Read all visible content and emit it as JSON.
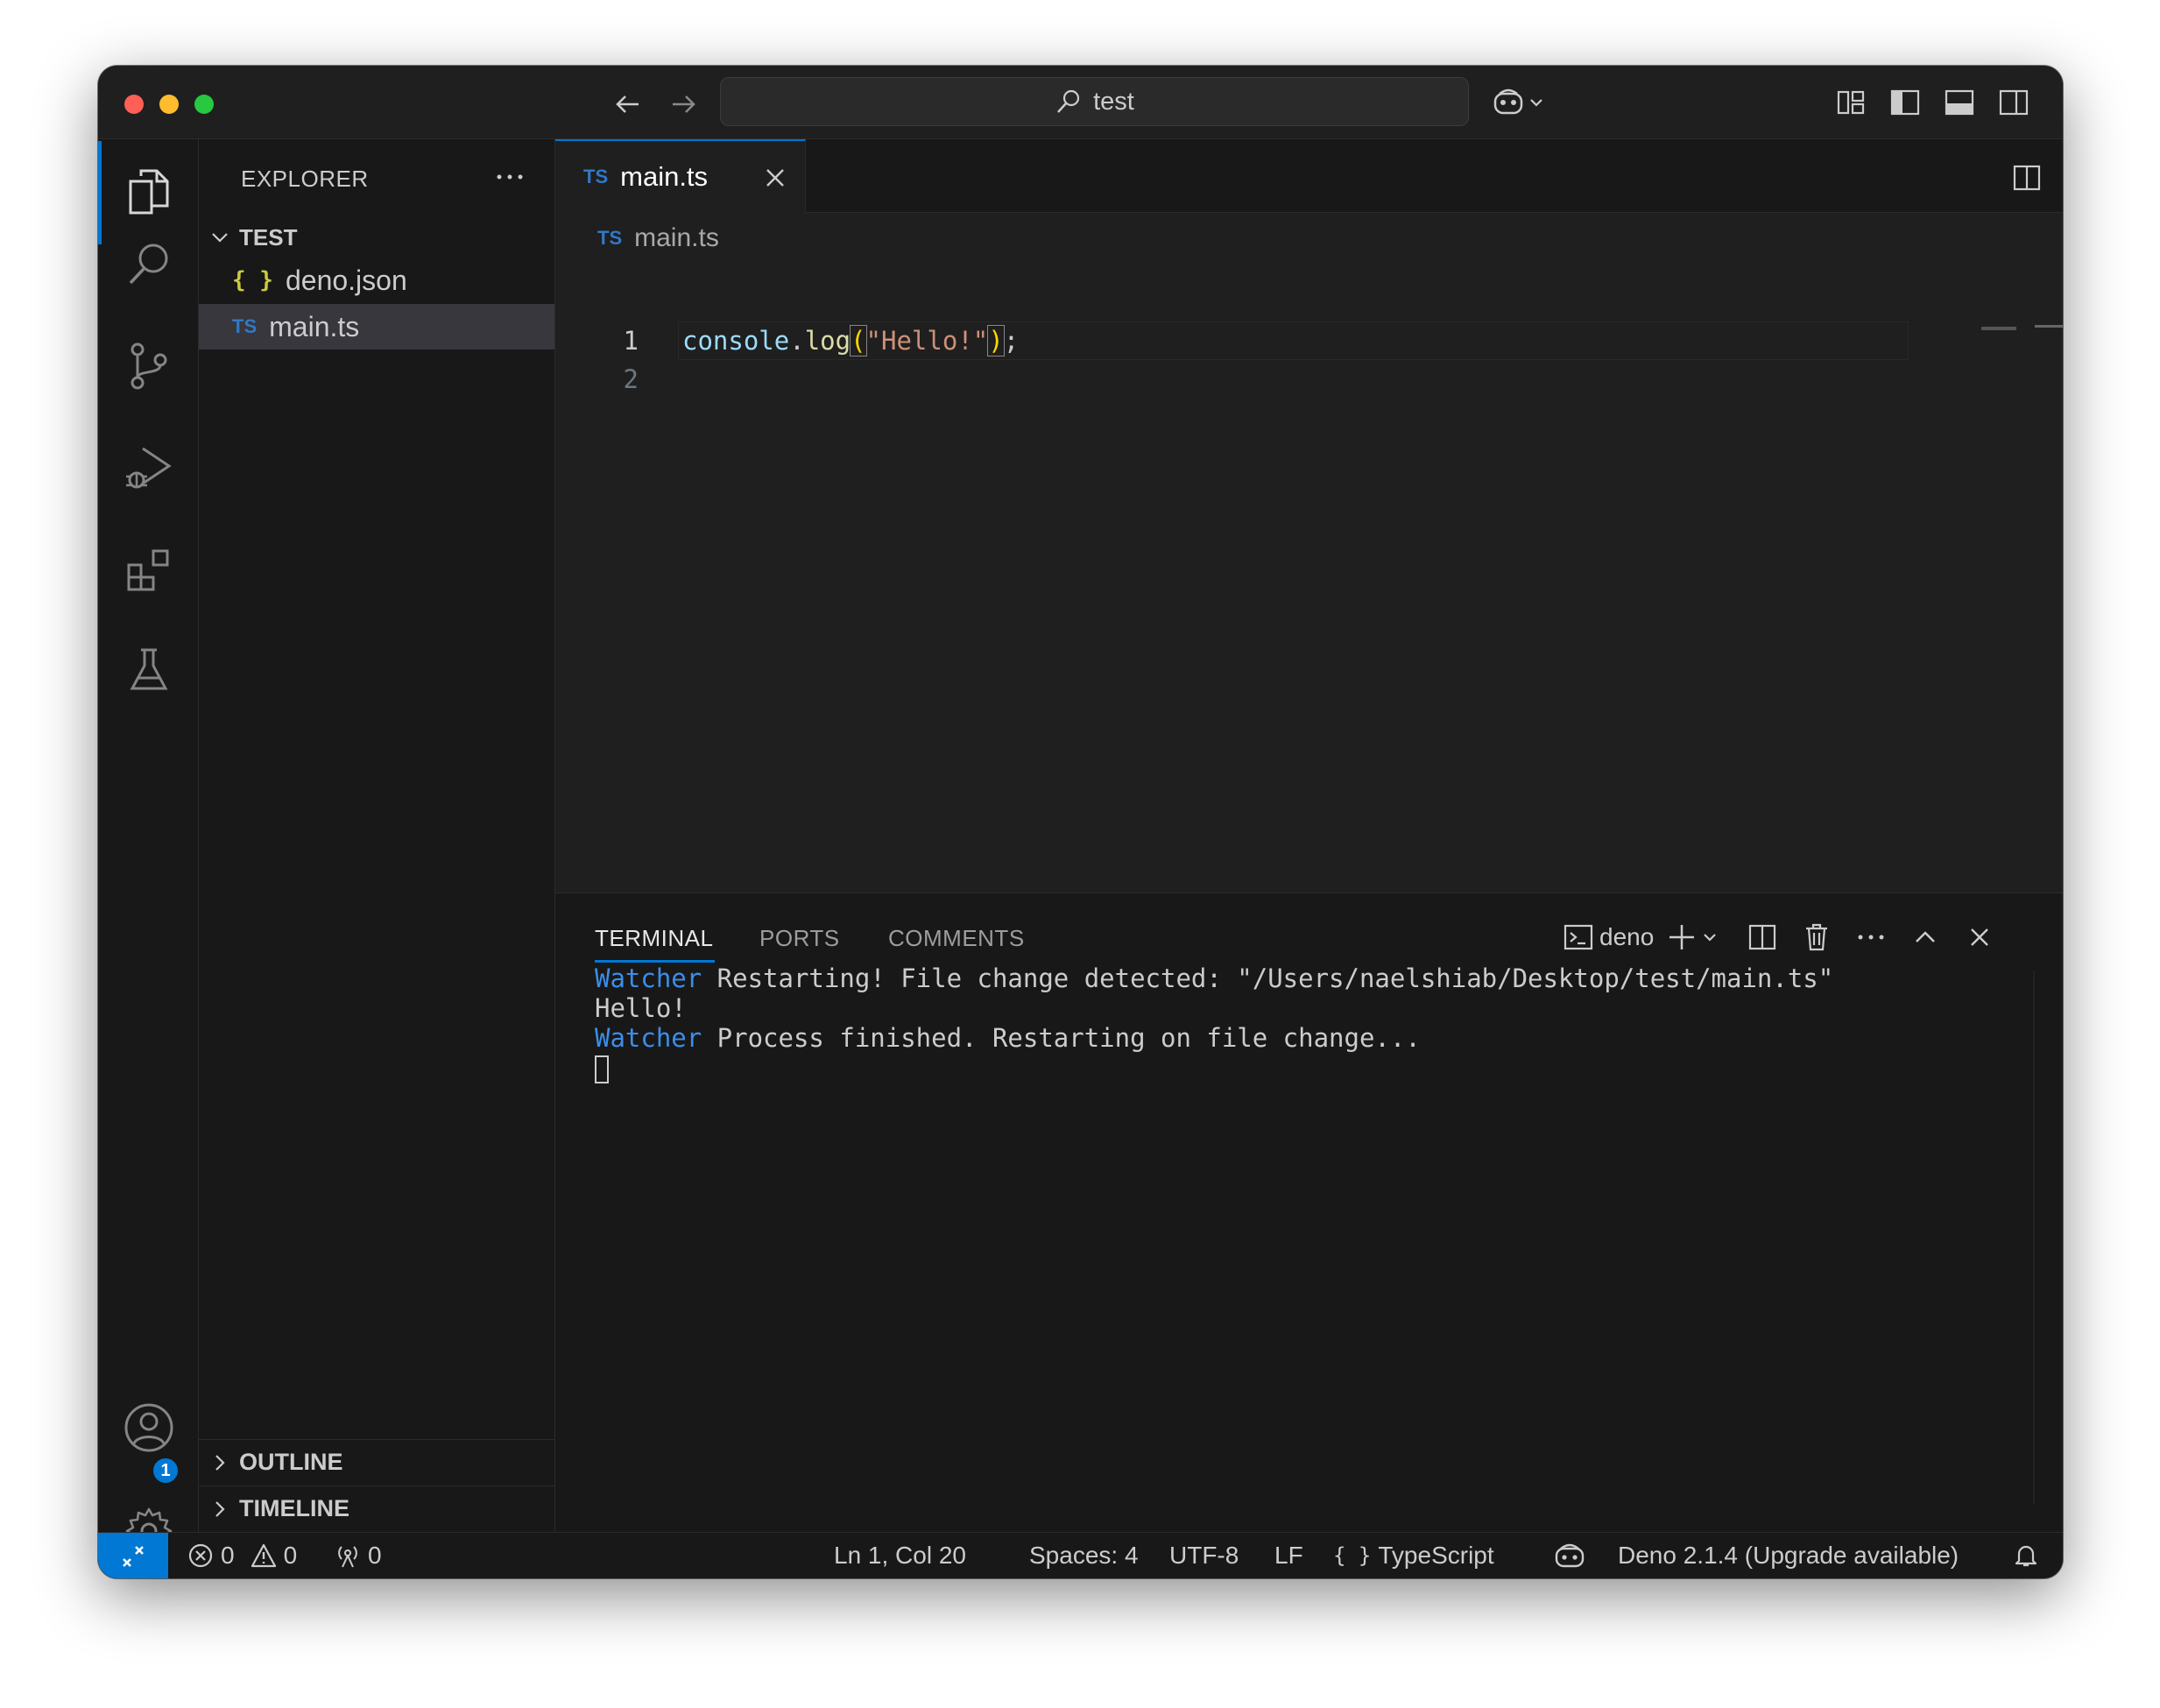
{
  "titlebar": {
    "search_text": "test"
  },
  "sidebar": {
    "title": "EXPLORER",
    "folder": "TEST",
    "files": [
      {
        "name": "deno.json",
        "icon": "{ }"
      },
      {
        "name": "main.ts",
        "icon": "TS"
      }
    ],
    "sections": [
      "OUTLINE",
      "TIMELINE"
    ],
    "accounts_badge": "1"
  },
  "editor": {
    "tab_label": "main.ts",
    "tab_icon": "TS",
    "breadcrumb": "main.ts",
    "lines": [
      {
        "num": "1",
        "tokens": [
          {
            "t": "console",
            "c": "var"
          },
          {
            "t": ".",
            "c": "punc"
          },
          {
            "t": "log",
            "c": "fn"
          },
          {
            "t": "(",
            "c": "br"
          },
          {
            "t": "\"Hello!\"",
            "c": "str"
          },
          {
            "t": ")",
            "c": "br"
          },
          {
            "t": ";",
            "c": "punc"
          }
        ]
      },
      {
        "num": "2",
        "tokens": []
      }
    ]
  },
  "panel": {
    "tabs": [
      "TERMINAL",
      "PORTS",
      "COMMENTS"
    ],
    "terminal_name": "deno",
    "output": [
      {
        "prefix": "Watcher",
        "text": " Restarting! File change detected: \"/Users/naelshiab/Desktop/test/main.ts\""
      },
      {
        "prefix": "",
        "text": "Hello!"
      },
      {
        "prefix": "Watcher",
        "text": " Process finished. Restarting on file change..."
      }
    ]
  },
  "statusbar": {
    "errors": "0",
    "warnings": "0",
    "ports": "0",
    "position": "Ln 1, Col 20",
    "spaces": "Spaces: 4",
    "encoding": "UTF-8",
    "eol": "LF",
    "language": "TypeScript",
    "runtime": "Deno 2.1.4 (Upgrade available)"
  },
  "colors": {
    "accent": "#0078d4",
    "background": "#181818",
    "editor_bg": "#1f1f1f",
    "ts_icon": "#3178c6",
    "json_icon": "#cbcb41",
    "terminal_blue": "#3b8eea"
  }
}
